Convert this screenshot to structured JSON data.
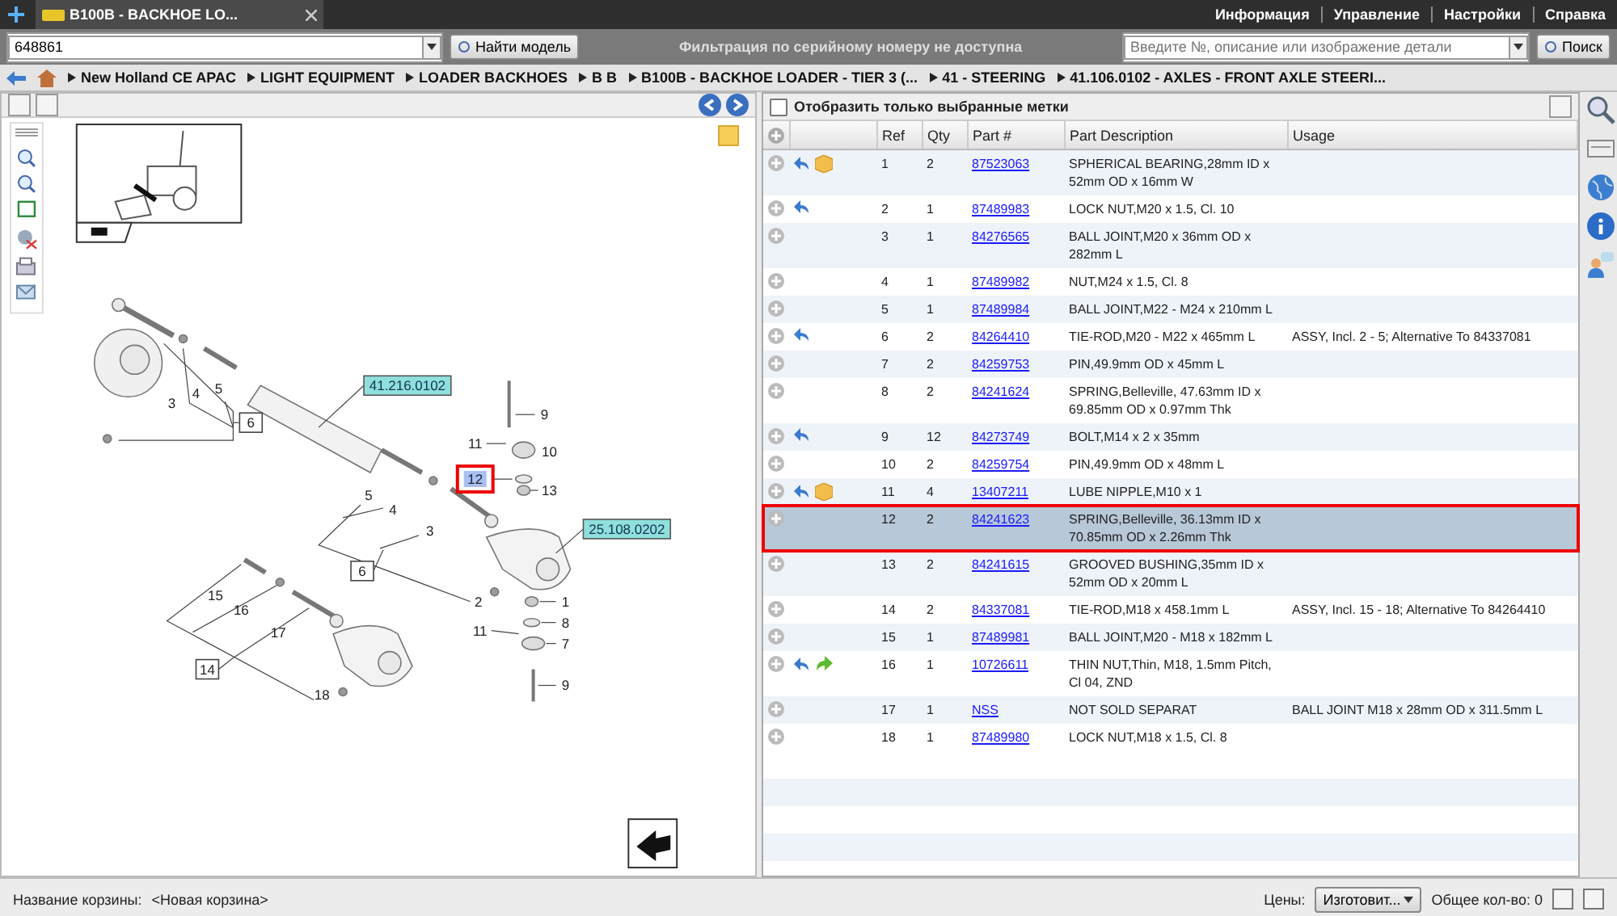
{
  "tab": {
    "title": "B100B - BACKHOE LO..."
  },
  "top_menu": [
    "Информация",
    "Управление",
    "Настройки",
    "Справка"
  ],
  "toolbar": {
    "model_field": {
      "value": "648861"
    },
    "find_button": "Найти модель",
    "serial_notice": "Фильтрация по серийному номеру не доступна",
    "search_field": {
      "placeholder": "Введите №, описание или изображение детали"
    },
    "search_button": "Поиск"
  },
  "breadcrumb": [
    "New Holland CE APAC",
    "LIGHT EQUIPMENT",
    "LOADER BACKHOES",
    "B B",
    "B100B - BACKHOE LOADER - TIER 3 (...",
    "41 - STEERING",
    "41.106.0102 - AXLES - FRONT AXLE STEERI..."
  ],
  "diagram": {
    "callouts": [
      {
        "label": "41.216.0102",
        "kind": "reference"
      },
      {
        "label": "5",
        "kind": "plain"
      },
      {
        "label": "4",
        "kind": "plain"
      },
      {
        "label": "3",
        "kind": "plain"
      },
      {
        "label": "9",
        "kind": "plain"
      },
      {
        "label": "6",
        "kind": "boxed"
      },
      {
        "label": "11",
        "kind": "plain"
      },
      {
        "label": "10",
        "kind": "plain"
      },
      {
        "label": "12",
        "kind": "highlighted"
      },
      {
        "label": "13",
        "kind": "plain"
      },
      {
        "label": "5",
        "kind": "plain"
      },
      {
        "label": "4",
        "kind": "plain"
      },
      {
        "label": "25.108.0202",
        "kind": "reference"
      },
      {
        "label": "3",
        "kind": "plain"
      },
      {
        "label": "6",
        "kind": "boxed"
      },
      {
        "label": "15",
        "kind": "plain"
      },
      {
        "label": "2",
        "kind": "plain"
      },
      {
        "label": "1",
        "kind": "plain"
      },
      {
        "label": "16",
        "kind": "plain"
      },
      {
        "label": "8",
        "kind": "plain"
      },
      {
        "label": "11",
        "kind": "plain"
      },
      {
        "label": "17",
        "kind": "plain"
      },
      {
        "label": "7",
        "kind": "plain"
      },
      {
        "label": "14",
        "kind": "boxed"
      },
      {
        "label": "9",
        "kind": "plain"
      },
      {
        "label": "18",
        "kind": "plain"
      }
    ]
  },
  "parts": {
    "filter": {
      "label": "Отобразить только выбранные метки",
      "checked": false
    },
    "columns": [
      "Ref",
      "Qty",
      "Part #",
      "Part Description",
      "Usage"
    ],
    "rows": [
      {
        "icons": [
          {
            "kind": "back"
          },
          {
            "kind": "box"
          }
        ],
        "ref": "1",
        "qty": "2",
        "part": "87523063",
        "description": "SPHERICAL BEARING,28mm ID x 52mm OD x 16mm W",
        "selected": false
      },
      {
        "icons": [
          {
            "kind": "back"
          }
        ],
        "ref": "2",
        "qty": "1",
        "part": "87489983",
        "description": "LOCK NUT,M20 x 1.5, Cl. 10",
        "selected": false
      },
      {
        "icons": [],
        "ref": "3",
        "qty": "1",
        "part": "84276565",
        "description": "BALL JOINT,M20 x 36mm OD x 282mm L",
        "selected": false
      },
      {
        "icons": [],
        "ref": "4",
        "qty": "1",
        "part": "87489982",
        "description": "NUT,M24 x 1.5, Cl. 8",
        "selected": false
      },
      {
        "icons": [],
        "ref": "5",
        "qty": "1",
        "part": "87489984",
        "description": "BALL JOINT,M22 - M24 x 210mm L",
        "selected": false
      },
      {
        "icons": [
          {
            "kind": "back"
          }
        ],
        "ref": "6",
        "qty": "2",
        "part": "84264410",
        "description": "TIE-ROD,M20 - M22 x 465mm L",
        "usage": "ASSY, Incl. 2 - 5; Alternative To 84337081",
        "selected": false
      },
      {
        "icons": [],
        "ref": "7",
        "qty": "2",
        "part": "84259753",
        "description": "PIN,49.9mm OD x 45mm L",
        "selected": false
      },
      {
        "icons": [],
        "ref": "8",
        "qty": "2",
        "part": "84241624",
        "description": "SPRING,Belleville, 47.63mm ID x 69.85mm OD x 0.97mm Thk",
        "selected": false
      },
      {
        "icons": [
          {
            "kind": "back"
          }
        ],
        "ref": "9",
        "qty": "12",
        "part": "84273749",
        "description": "BOLT,M14 x 2 x 35mm",
        "selected": false
      },
      {
        "icons": [],
        "ref": "10",
        "qty": "2",
        "part": "84259754",
        "description": "PIN,49.9mm OD x 48mm L",
        "selected": false
      },
      {
        "icons": [
          {
            "kind": "back"
          },
          {
            "kind": "box"
          }
        ],
        "ref": "11",
        "qty": "4",
        "part": "13407211",
        "description": "LUBE NIPPLE,M10 x 1",
        "selected": false
      },
      {
        "icons": [],
        "ref": "12",
        "qty": "2",
        "part": "84241623",
        "description": "SPRING,Belleville, 36.13mm ID x 70.85mm OD x 2.26mm Thk",
        "selected": true
      },
      {
        "icons": [],
        "ref": "13",
        "qty": "2",
        "part": "84241615",
        "description": "GROOVED BUSHING,35mm ID x 52mm OD x 20mm L",
        "selected": false
      },
      {
        "icons": [],
        "ref": "14",
        "qty": "2",
        "part": "84337081",
        "description": "TIE-ROD,M18 x 458.1mm L",
        "usage": "ASSY, Incl. 15 - 18; Alternative To 84264410",
        "selected": false
      },
      {
        "icons": [],
        "ref": "15",
        "qty": "1",
        "part": "87489981",
        "description": "BALL JOINT,M20 - M18 x 182mm L",
        "selected": false
      },
      {
        "icons": [
          {
            "kind": "back"
          },
          {
            "kind": "forward"
          }
        ],
        "ref": "16",
        "qty": "1",
        "part": "10726611",
        "description": "THIN NUT,Thin, M18, 1.5mm Pitch, Cl 04, ZND",
        "selected": false
      },
      {
        "icons": [],
        "ref": "17",
        "qty": "1",
        "part": "NSS",
        "description": "NOT SOLD SEPARAT",
        "usage": "BALL JOINT M18 x 28mm OD x 311.5mm L",
        "selected": false
      },
      {
        "icons": [],
        "ref": "18",
        "qty": "1",
        "part": "87489980",
        "description": "LOCK NUT,M18 x 1.5, Cl. 8",
        "selected": false
      }
    ]
  },
  "status_bar": {
    "basket_label": "Название корзины:",
    "basket_name": "<Новая корзина>",
    "prices_label": "Цены:",
    "prices_select": "Изготовит...",
    "total": "Общее кол-во: 0"
  }
}
